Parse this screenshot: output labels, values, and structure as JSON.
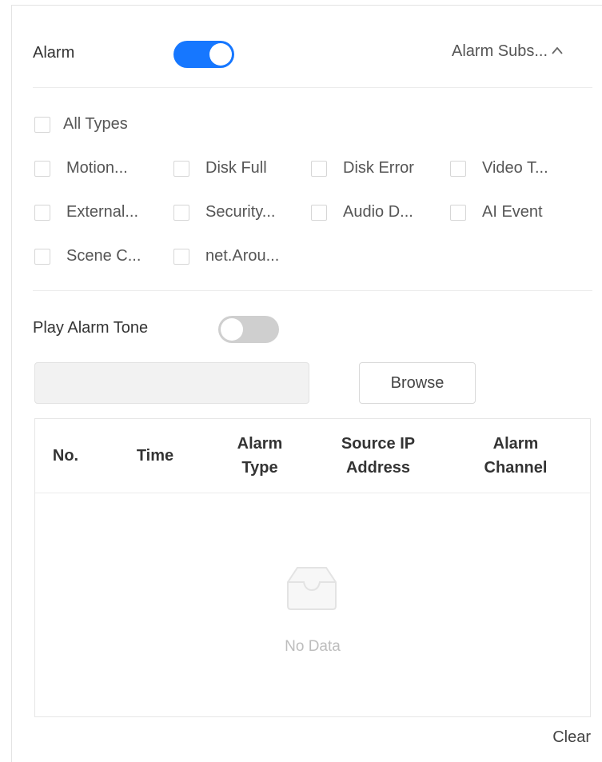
{
  "alarm": {
    "label": "Alarm",
    "enabled": true,
    "subscribe_label": "Alarm Subs...",
    "subscribe_expanded": true
  },
  "types": {
    "all": "All Types",
    "items": [
      "Motion...",
      "Disk Full",
      "Disk Error",
      "Video T...",
      "External...",
      "Security...",
      "Audio D...",
      "AI Event",
      "Scene C...",
      "net.Arou..."
    ]
  },
  "tone": {
    "label": "Play Alarm Tone",
    "enabled": false,
    "file_value": "",
    "browse_label": "Browse"
  },
  "table": {
    "headers": [
      [
        "No."
      ],
      [
        "Time"
      ],
      [
        "Alarm",
        "Type"
      ],
      [
        "Source IP",
        "Address"
      ],
      [
        "Alarm",
        "Channel"
      ]
    ],
    "rows": [],
    "empty_text": "No Data"
  },
  "clear_label": "Clear",
  "colors": {
    "accent": "#1677ff",
    "switch_off": "#cfcfcf"
  },
  "icons": {
    "collapse": "chevron-up-icon",
    "empty": "empty-inbox-icon"
  }
}
